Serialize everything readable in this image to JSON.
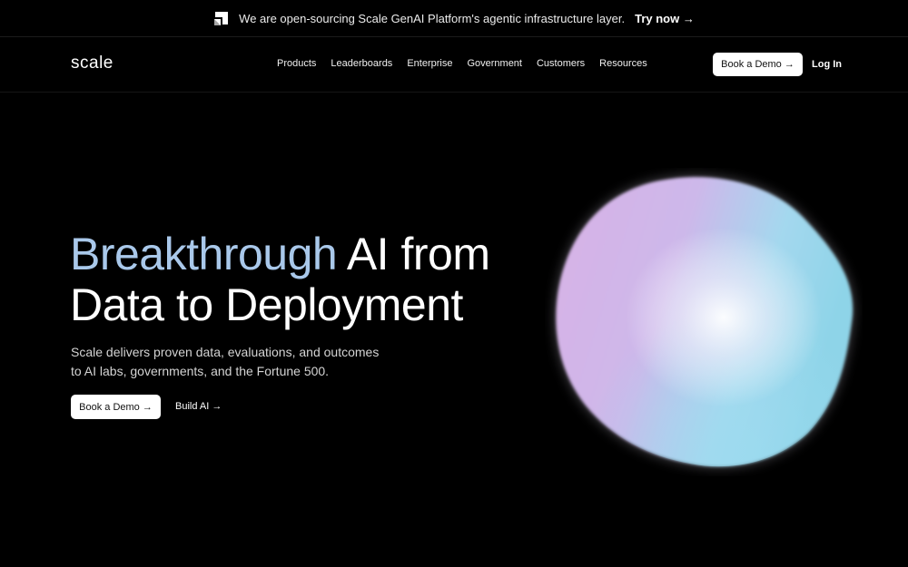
{
  "announcement": {
    "text": "We are open-sourcing Scale GenAI Platform's agentic infrastructure layer.",
    "cta": "Try now →",
    "icon": "scale-mark-icon"
  },
  "nav": {
    "brand": "scale",
    "items": [
      "Products",
      "Leaderboards",
      "Enterprise",
      "Government",
      "Customers",
      "Resources"
    ],
    "demo_button": "Book a Demo →",
    "login": "Log In"
  },
  "hero": {
    "title_accent": "Breakthrough",
    "title_rest_line1": " AI from",
    "title_line2": "Data to Deployment",
    "subtitle_line1": "Scale delivers proven data, evaluations, and outcomes",
    "subtitle_line2": "to AI labs, governments, and the Fortune 500.",
    "primary_button": "Book a Demo →",
    "secondary_link": "Build AI →",
    "visual": "gradient-orb"
  },
  "colors": {
    "background": "#000000",
    "accent_text": "#a9c8ea",
    "button_bg": "#ffffff",
    "orb_violet": "#d5b4e8",
    "orb_cyan": "#8ed9ec"
  }
}
